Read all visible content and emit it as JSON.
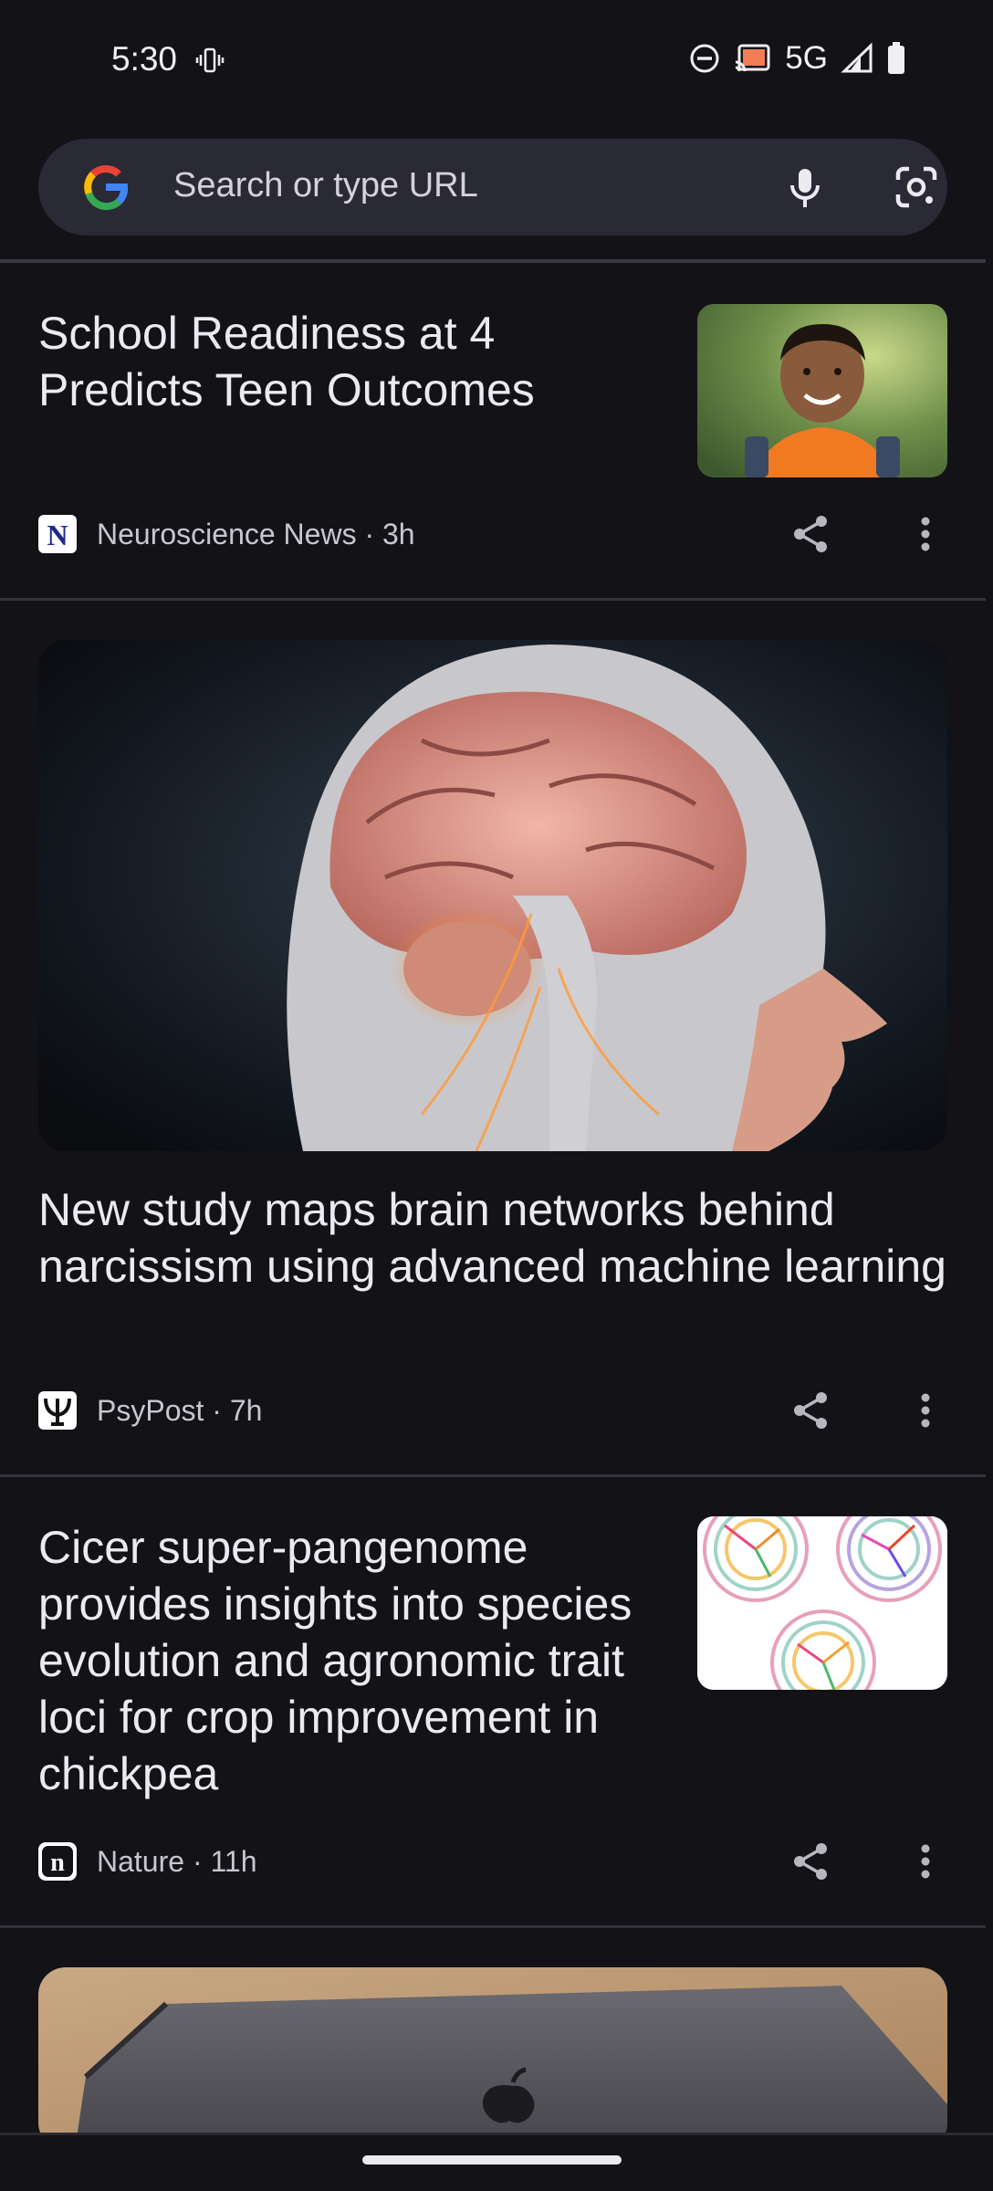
{
  "status_bar": {
    "time": "5:30",
    "network": "5G",
    "icons": [
      "vibrate-icon",
      "do-not-disturb-icon",
      "cast-icon",
      "signal-icon",
      "battery-icon"
    ]
  },
  "search": {
    "placeholder": "Search or type URL",
    "icons": [
      "google-logo",
      "mic-icon",
      "lens-icon"
    ]
  },
  "feed": [
    {
      "title": "School Readiness at 4 Predicts Teen Outcomes",
      "source": "Neuroscience News",
      "age": "3h",
      "meta": "Neuroscience News · 3h",
      "image": "child-with-backpack-thumbnail"
    },
    {
      "title": "New study maps brain networks behind narcissism using advanced machine learning",
      "source": "PsyPost",
      "age": "7h",
      "meta": "PsyPost · 7h",
      "image": "glowing-brain-profile-hero"
    },
    {
      "title": "Cicer super-pangenome provides insights into species evolution and agronomic trait loci for crop improvement in chickpea",
      "source": "Nature",
      "age": "11h",
      "meta": "Nature · 11h",
      "image": "circos-plot-thumbnail"
    },
    {
      "image": "laptop-on-wood-table-hero"
    }
  ],
  "colors": {
    "background": "#131217",
    "search_bg": "#2a2936",
    "text_primary": "#ece9f0",
    "text_secondary": "#c9c6cf"
  }
}
